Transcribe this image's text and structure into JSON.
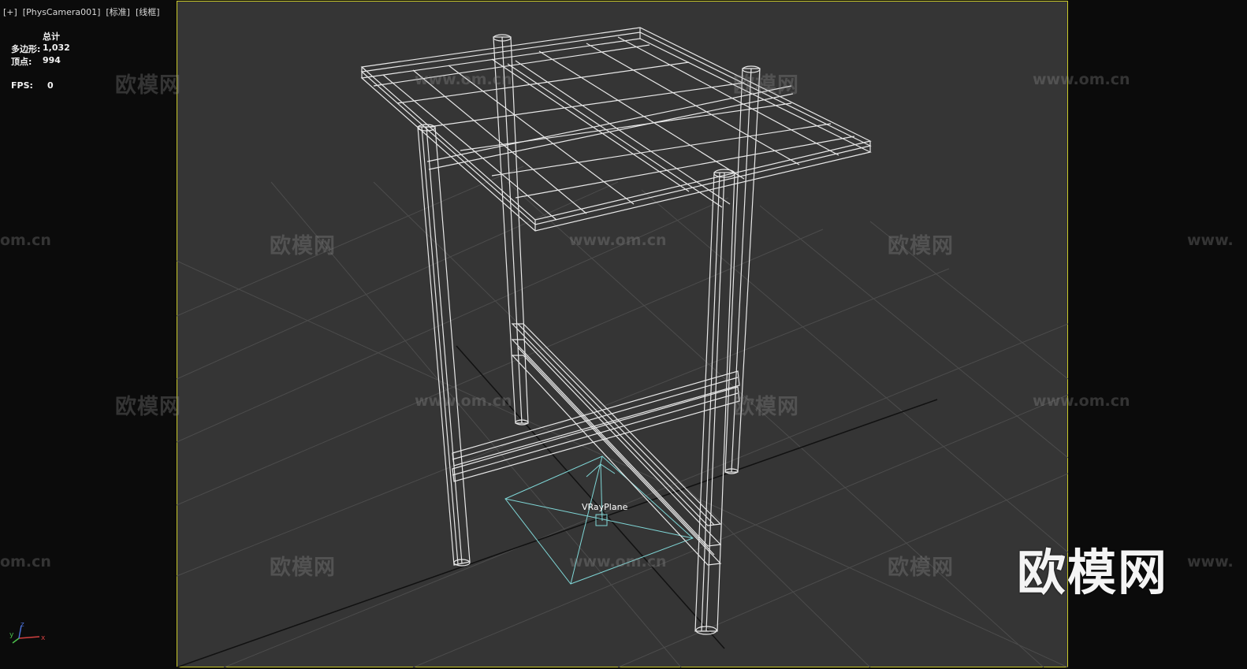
{
  "viewport": {
    "label": "[+]  [PhysCamera001]  [标准]  [线框]"
  },
  "stats": {
    "header": "总计",
    "polygons_label": "多边形:",
    "polygons_value": "1,032",
    "vertices_label": "顶点:",
    "vertices_value": "994",
    "fps_label": "FPS:",
    "fps_value": "0"
  },
  "watermark": {
    "brand": "欧模网",
    "url": "www.om.cn",
    "url_left_fragment": "om.cn",
    "url_right_fragment": "www.",
    "logo": "欧模网"
  },
  "scene": {
    "helper_label": "VRayPlane",
    "axes": {
      "x": "x",
      "y": "y",
      "z": "z"
    }
  },
  "colors": {
    "viewport_bg": "#353535",
    "border_active": "#c9c92a",
    "wire": "#e8e8e8",
    "helper": "#7fd6d6",
    "grid": "#4a4a4a"
  }
}
